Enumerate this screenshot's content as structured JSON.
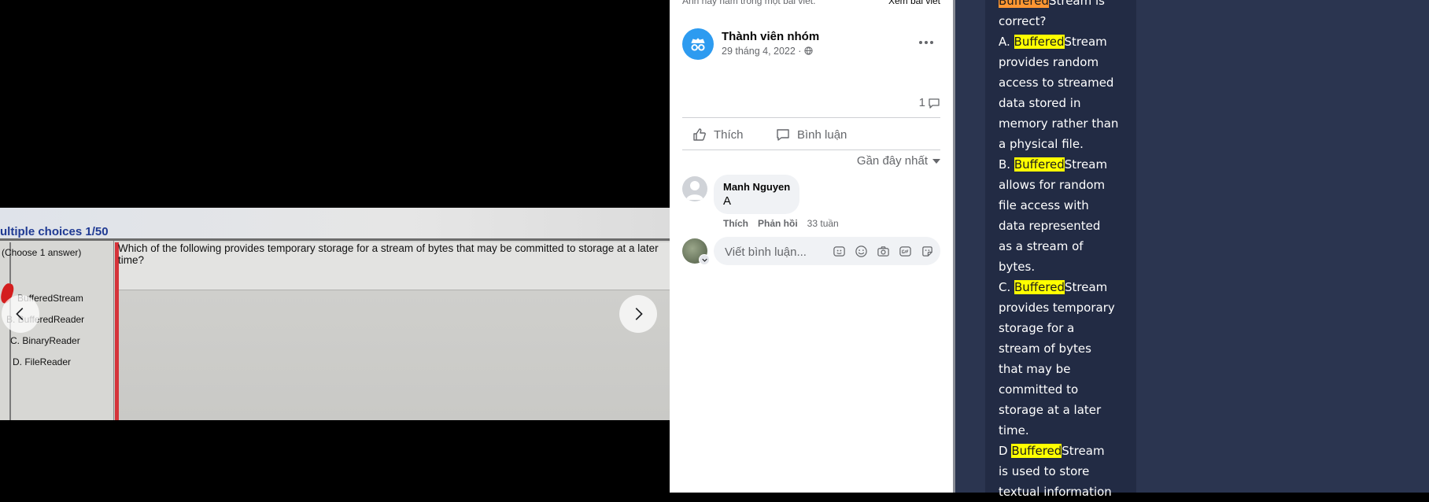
{
  "viewer": {
    "header_text": "ultiple choices 1/50",
    "choose_text": "(Choose 1 answer)",
    "question": "Which of the following provides temporary storage for a stream of bytes that may be committed to storage at a later time?",
    "options": [
      "BufferedStream",
      "B. BufferedReader",
      "C. BinaryReader",
      "D. FileReader"
    ],
    "prev_icon": "chevron-left-icon",
    "next_icon": "chevron-right-icon"
  },
  "post": {
    "top_left": "Ảnh này nằm trong một bài viết.",
    "top_right": "Xem bài viết",
    "poster_name": "Thành viên nhóm",
    "date": "29 tháng 4, 2022 ·",
    "comment_count": "1",
    "like_label": "Thích",
    "comment_label": "Bình luận",
    "sort_label": "Gần đây nhất"
  },
  "comment": {
    "author": "Manh Nguyen",
    "text": "A",
    "like": "Thích",
    "reply": "Phản hồi",
    "time": "33 tuần"
  },
  "composer": {
    "placeholder": "Viết bình luận..."
  },
  "quiz": {
    "colors": {
      "highlight": "#ffff00",
      "highlight_current": "#ff9632",
      "panel_bg": "#2b3550"
    },
    "lines": [
      {
        "pre": "",
        "hl": "Buffered",
        "post": "Stream is",
        "current": true
      },
      {
        "text": "correct?"
      },
      {
        "pre": "A. ",
        "hl": "Buffered",
        "post": "Stream"
      },
      {
        "text": "provides random"
      },
      {
        "text": "access to streamed"
      },
      {
        "text": "data stored in"
      },
      {
        "text": "memory rather than"
      },
      {
        "text": "a physical file."
      },
      {
        "pre": "B. ",
        "hl": "Buffered",
        "post": "Stream"
      },
      {
        "text": "allows for random"
      },
      {
        "text": "file access with"
      },
      {
        "text": "data represented"
      },
      {
        "text": "as a stream of"
      },
      {
        "text": "bytes."
      },
      {
        "pre": "C. ",
        "hl": "Buffered",
        "post": "Stream"
      },
      {
        "text": "provides temporary"
      },
      {
        "text": "storage for a"
      },
      {
        "text": "stream of bytes"
      },
      {
        "text": "that may be"
      },
      {
        "text": "committed to"
      },
      {
        "text": "storage at a later"
      },
      {
        "text": "time."
      },
      {
        "pre": "D ",
        "hl": "Buffered",
        "post": "Stream"
      },
      {
        "text": "is used to store"
      },
      {
        "text": "textual information"
      }
    ]
  }
}
